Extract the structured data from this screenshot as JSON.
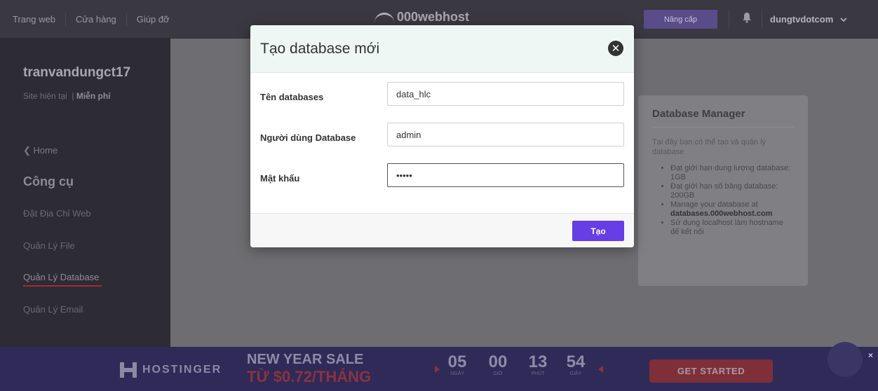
{
  "topbar": {
    "nav": [
      "Trang web",
      "Cửa hàng",
      "Giúp đỡ"
    ],
    "logo_text": "000webhost",
    "upgrade_label": "Nâng cấp",
    "username": "dungtvdotcom"
  },
  "sidebar": {
    "site_name": "tranvandungct17",
    "site_status_prefix": "Site hiện tại",
    "site_plan": "Miễn phí",
    "home_label": "Home",
    "tools_title": "Công cụ",
    "items": [
      "Đặt Địa Chỉ Web",
      "Quản Lý File",
      "Quản Lý Database",
      "Quản Lý Email"
    ],
    "active_item": "Quản Lý Database"
  },
  "info_card": {
    "title": "Database Manager",
    "intro": "Tại đây bạn có thể tạo và quản lý database",
    "bullets": [
      "Đạt giới hạn dung lượng database: 1GB",
      "Đạt giới hạn số bảng database: 200GB",
      "Manage your database at",
      "databases.000webhost.com",
      "Sử dụng localhost làm hostname để kết nối"
    ]
  },
  "modal": {
    "title": "Tạo database mới",
    "fields": [
      {
        "label": "Tên databases",
        "value": "data_hlc"
      },
      {
        "label": "Người dùng Database",
        "value": "admin"
      },
      {
        "label": "Mật khẩu",
        "value": "•••••"
      }
    ],
    "submit_label": "Tạo"
  },
  "banner": {
    "brand": "HOSTINGER",
    "sale_line1": "NEW YEAR SALE",
    "sale_line2": "TỪ $0.72/THÁNG",
    "countdown": [
      {
        "value": "05",
        "label": "NGÀY"
      },
      {
        "value": "00",
        "label": "GIỜ"
      },
      {
        "value": "13",
        "label": "PHÚT"
      },
      {
        "value": "54",
        "label": "GIÂY"
      }
    ],
    "cta_label": "GET STARTED",
    "close_glyph": "×"
  },
  "colors": {
    "accent_purple": "#673de6",
    "active_underline": "#a52a3a"
  }
}
